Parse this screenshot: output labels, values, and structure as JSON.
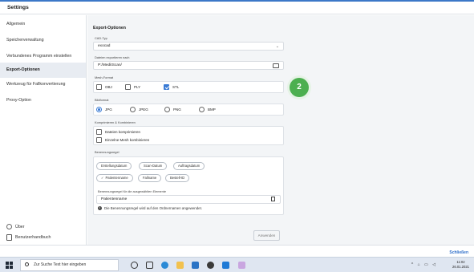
{
  "window": {
    "title": "Settings"
  },
  "sidebar": {
    "items": [
      {
        "label": "Allgemein",
        "active": false
      },
      {
        "label": "Speicherverwaltung",
        "active": false
      },
      {
        "label": "Verbundenes Programm einstellen",
        "active": false
      },
      {
        "label": "Export-Optionen",
        "active": true
      },
      {
        "label": "Werkzeug für Fallkonvertierung",
        "active": false
      },
      {
        "label": "Proxy-Option",
        "active": false
      }
    ],
    "about": "Über",
    "manual": "Benutzerhandbuch"
  },
  "export": {
    "title": "Export-Optionen",
    "cad_type_label": "CAD-Typ",
    "cad_type_value": "exocad",
    "path_label": "Dateien exportieren nach",
    "path_value": "P:/MeditScan/",
    "mesh_format_label": "Mesh-Format",
    "mesh_formats": [
      {
        "label": "OBJ",
        "checked": false
      },
      {
        "label": "PLY",
        "checked": false
      },
      {
        "label": "STL",
        "checked": true
      }
    ],
    "image_format_label": "Bildformat",
    "image_formats": [
      {
        "label": "JPG",
        "checked": true
      },
      {
        "label": "JPEG",
        "checked": false
      },
      {
        "label": "PNG",
        "checked": false
      },
      {
        "label": "BMP",
        "checked": false
      }
    ],
    "compress_label": "Komprimieren & Kombinieren",
    "compress_options": [
      {
        "label": "Dateien komprimieren",
        "checked": false
      },
      {
        "label": "Einzelne Mesh kombinieren",
        "checked": false
      }
    ],
    "naming_label": "Benennungsregel",
    "naming_chips_row1": [
      "Erstellungsdatum",
      "Scan-Datum",
      "Auftragsdatum"
    ],
    "naming_chips_row2": [
      {
        "label": "Patientenname",
        "selected": true
      },
      {
        "label": "Fallname",
        "selected": false
      },
      {
        "label": "Bestell-ID",
        "selected": false
      }
    ],
    "selected_rule_label": "Benennungsregel für die ausgewählten Elemente",
    "selected_rule_value": "Patientenname",
    "info_text": "Die Benennungsregel wird auf den Ordnernamen angewendet.",
    "apply_label": "Anwenden"
  },
  "badge": {
    "number": "2",
    "color": "#4caf50"
  },
  "footer": {
    "close_label": "Schließen"
  },
  "taskbar": {
    "search_placeholder": "Zur Suche Text hier eingeben",
    "time": "11:02",
    "date": "26.01.2021"
  },
  "colors": {
    "accent": "#3a7bd5",
    "link": "#2f6fca",
    "title_bar_top": "#3c78c8"
  }
}
